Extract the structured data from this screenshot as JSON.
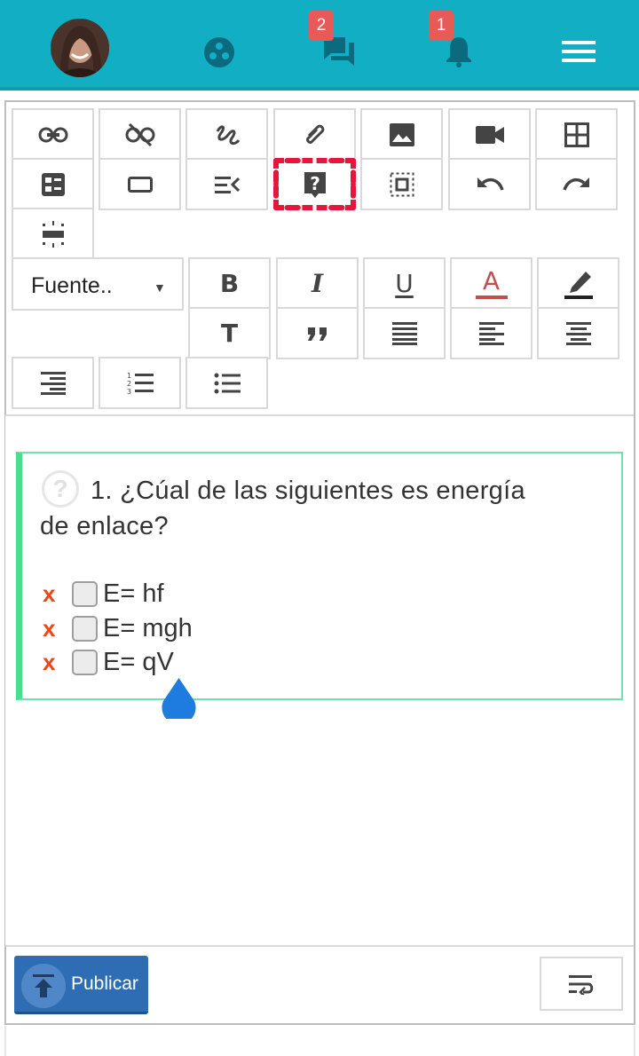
{
  "header": {
    "chat_badge": "2",
    "notifications_badge": "1"
  },
  "toolbar": {
    "font_select": "Fuente..",
    "bold": "B",
    "italic": "I",
    "underline": "U",
    "font_color": "A",
    "text_size": "T"
  },
  "question": {
    "number_and_text_line1": "1. ¿Cúal de las siguientes es energía",
    "text_line2": "de enlace?",
    "options": [
      {
        "mark": "x",
        "text": "E= hf"
      },
      {
        "mark": "x",
        "text": "E= mgh"
      },
      {
        "mark": "x",
        "text": "E= qV"
      }
    ]
  },
  "footer": {
    "publish_label": "Publicar"
  },
  "colors": {
    "topbar": "#11aec4",
    "publish": "#2e6db4",
    "highlight": "#e8153a",
    "question_border": "#47e08f",
    "wrong_mark": "#e8481a"
  }
}
